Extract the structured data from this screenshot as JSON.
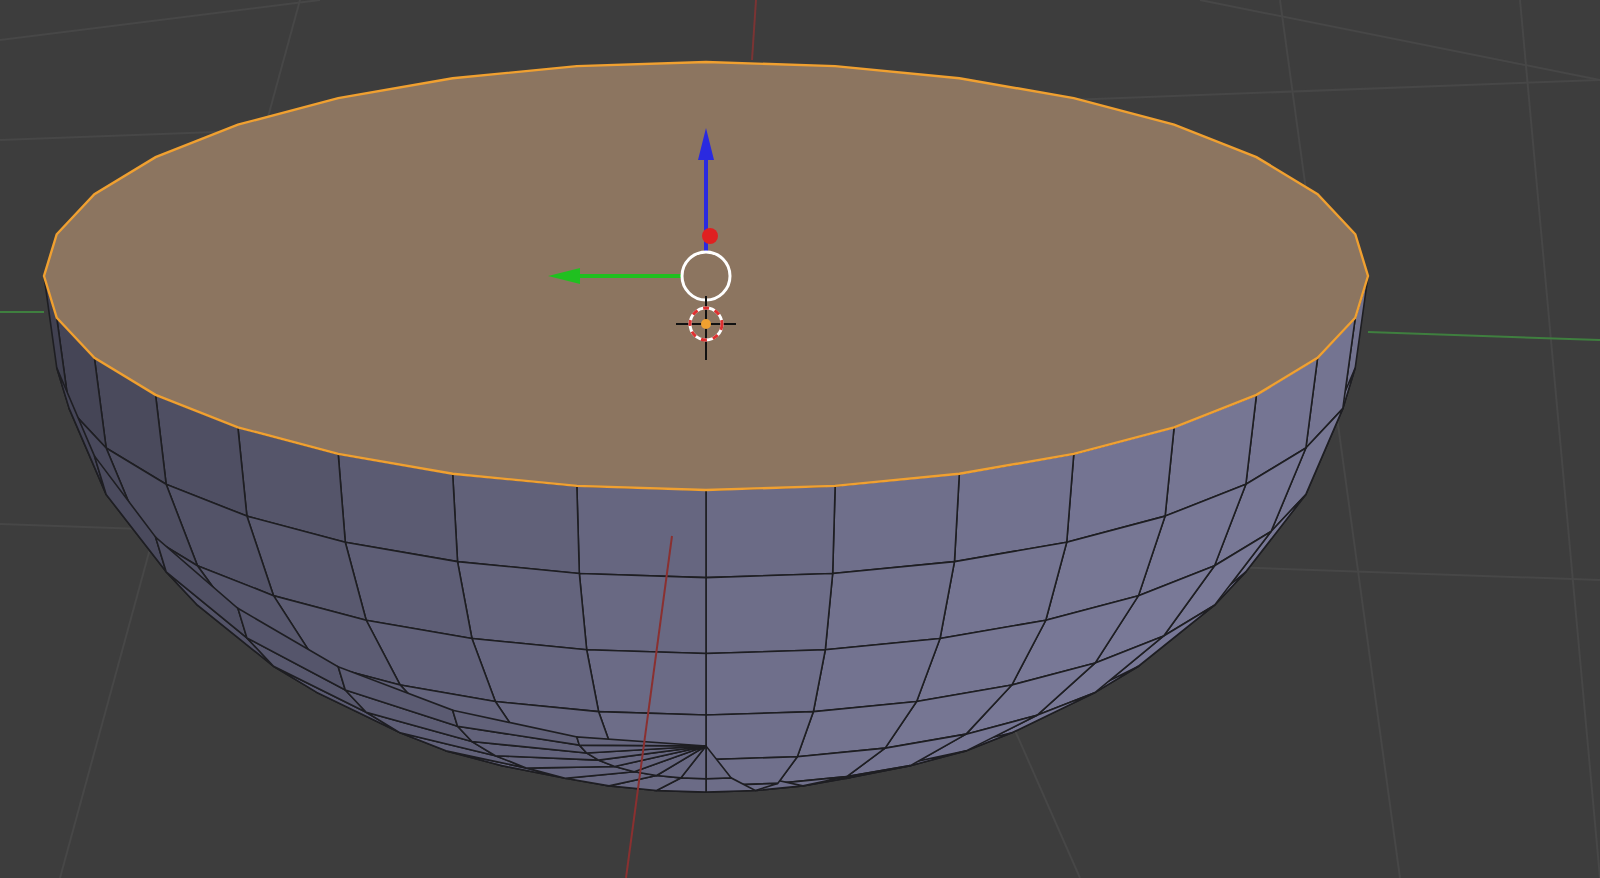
{
  "viewport": {
    "object": {
      "kind": "hemisphere",
      "top_face_selected": true
    }
  }
}
